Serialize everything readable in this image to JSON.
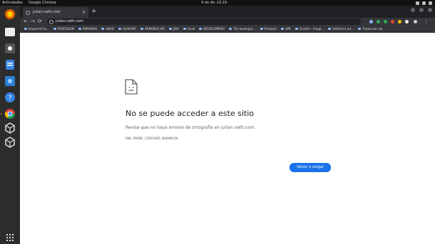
{
  "topbar": {
    "activities": "Actividades",
    "app_name": "Google Chrome",
    "clock": "4 de dic 10:19"
  },
  "tab": {
    "title": "julian.neth.com"
  },
  "omnibox": {
    "url": "julian.neth.com"
  },
  "bookmarks": [
    {
      "label": "Imported fro..."
    },
    {
      "label": "PROFESION"
    },
    {
      "label": "ARMOBUS"
    },
    {
      "label": "UNAD"
    },
    {
      "label": "GLOBANT"
    },
    {
      "label": "ARMOBUS WS"
    },
    {
      "label": "JIRA"
    },
    {
      "label": "Unad"
    },
    {
      "label": "DEVELOPMENT"
    },
    {
      "label": "The workspac..."
    },
    {
      "label": "Products"
    },
    {
      "label": "APK"
    },
    {
      "label": "Scratch - Imagi..."
    },
    {
      "label": "Untitled 4 art..."
    },
    {
      "label": "Traducción de..."
    }
  ],
  "error": {
    "title": "No se puede acceder a este sitio",
    "description": "Revisa que no haya errores de ortografía en julian.neth.com.",
    "code": "DNS_PROBE_FINISHED_NXDOMAIN",
    "reload_label": "Volver a cargar"
  },
  "colors": {
    "accent": "#1a73e8",
    "dock_bg": "#2c2c2c",
    "chrome_dark": "#35363a"
  },
  "dock_icons": [
    "firefox-icon",
    "files-icon",
    "terminal-icon",
    "document-icon",
    "photo-icon",
    "help-icon",
    "chrome-icon",
    "cube-icon",
    "cube-icon",
    "app-grid-icon"
  ]
}
